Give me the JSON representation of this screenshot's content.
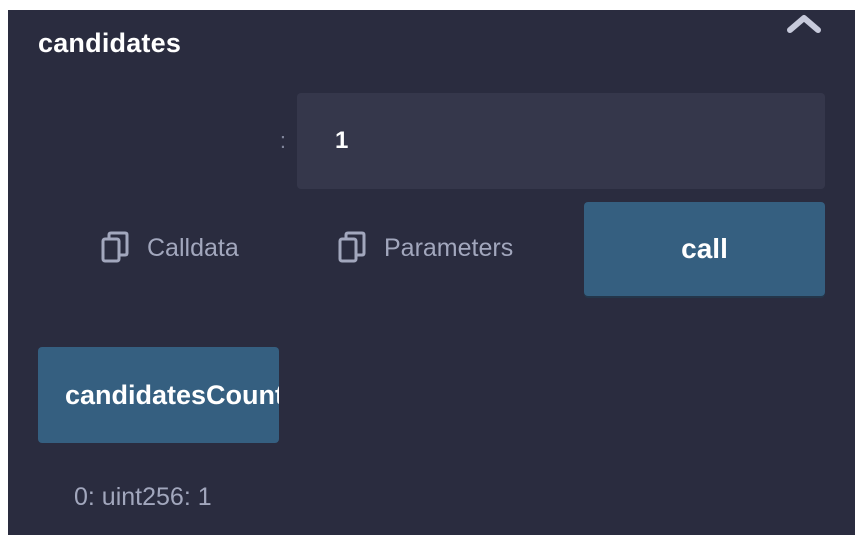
{
  "panel": {
    "title": "candidates",
    "collapse_icon": "chevron-up-icon"
  },
  "param": {
    "label": ":",
    "value": "1"
  },
  "actions": {
    "calldata_label": "Calldata",
    "calldata_icon": "copy-icon",
    "parameters_label": "Parameters",
    "parameters_icon": "copy-icon",
    "call_label": "call"
  },
  "function_button": {
    "label": "candidatesCount"
  },
  "result": {
    "text": "0: uint256: 1"
  },
  "colors": {
    "panel_bg": "#2a2c3f",
    "input_bg": "#35374b",
    "button_bg": "#355f80",
    "muted_text": "#a2a7bd"
  }
}
